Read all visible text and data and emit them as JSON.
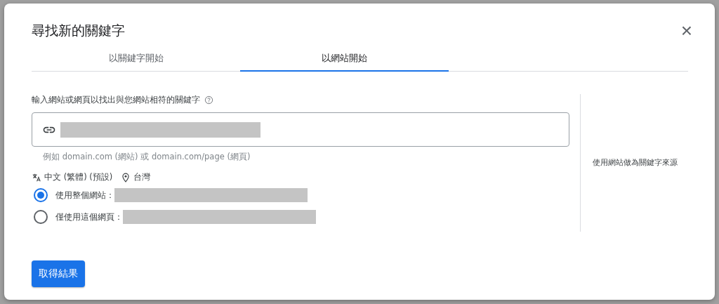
{
  "dialog": {
    "title": "尋找新的關鍵字",
    "close": "×"
  },
  "tabs": [
    {
      "label": "以關鍵字開始",
      "selected": false
    },
    {
      "label": "以網站開始",
      "selected": true
    }
  ],
  "form": {
    "label": "輸入網站或網頁以找出與您網站相符的關鍵字",
    "hint": "例如 domain.com (網站) 或 domain.com/page (網頁)",
    "language": "中文 (繁體) (預設)",
    "location": "台灣",
    "options": [
      {
        "label": "使用整個網站：",
        "selected": true
      },
      {
        "label": "僅使用這個網頁：",
        "selected": false
      }
    ]
  },
  "side_note": "使用網站做為關鍵字來源",
  "submit": "取得結果"
}
